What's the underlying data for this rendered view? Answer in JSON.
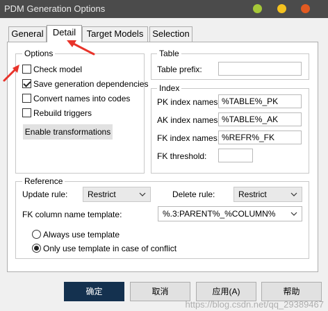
{
  "window": {
    "title": "PDM Generation Options"
  },
  "traffic_lights": [
    {
      "name": "minimize",
      "color": "#a6c838"
    },
    {
      "name": "maximize",
      "color": "#f4c21f"
    },
    {
      "name": "close",
      "color": "#e25a21"
    }
  ],
  "tabs": [
    {
      "label": "General"
    },
    {
      "label": "Detail",
      "active": true
    },
    {
      "label": "Target Models"
    },
    {
      "label": "Selection"
    }
  ],
  "options": {
    "legend": "Options",
    "check_model": {
      "label": "Check model",
      "checked": false
    },
    "save_dependencies": {
      "label": "Save generation dependencies",
      "checked": true
    },
    "convert_names": {
      "label": "Convert names into codes",
      "checked": false
    },
    "rebuild_triggers": {
      "label": "Rebuild triggers",
      "checked": false
    },
    "enable_transformations": "Enable transformations"
  },
  "table": {
    "legend": "Table",
    "prefix_label": "Table prefix:",
    "prefix_value": ""
  },
  "index": {
    "legend": "Index",
    "pk_label": "PK index names:",
    "pk_value": "%TABLE%_PK",
    "ak_label": "AK index names:",
    "ak_value": "%TABLE%_AK",
    "fk_label": "FK index names:",
    "fk_value": "%REFR%_FK",
    "threshold_label": "FK threshold:",
    "threshold_value": ""
  },
  "reference": {
    "legend": "Reference",
    "update_label": "Update rule:",
    "update_value": "Restrict",
    "delete_label": "Delete rule:",
    "delete_value": "Restrict",
    "template_label": "FK column name template:",
    "template_value": "%.3:PARENT%_%COLUMN%",
    "always_template": {
      "label": "Always use template",
      "selected": false
    },
    "conflict_template": {
      "label": "Only use template in case of conflict",
      "selected": true
    }
  },
  "buttons": {
    "ok": "确定",
    "cancel": "取消",
    "apply": "应用(A)",
    "help": "帮助"
  },
  "annotation_color": "#e8332a",
  "watermark": "https://blog.csdn.net/qq_29389467"
}
